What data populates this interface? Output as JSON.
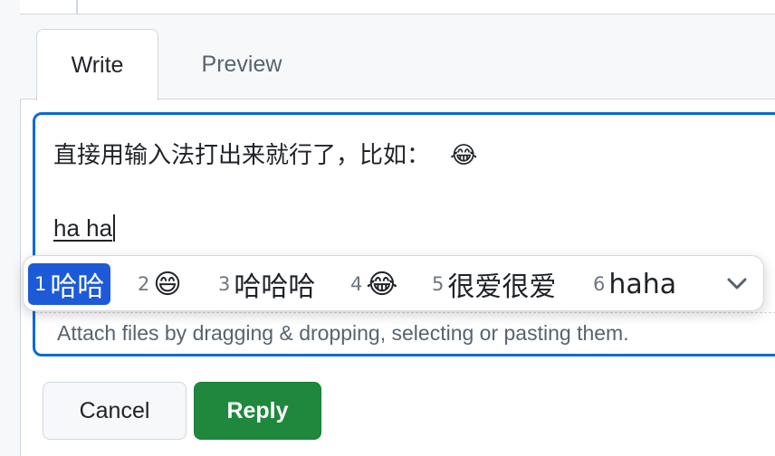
{
  "tabs": [
    {
      "label": "Write",
      "active": true
    },
    {
      "label": "Preview",
      "active": false
    }
  ],
  "editor": {
    "line1_text": "直接用输入法打出来就行了，比如：",
    "line1_emoji": "😂",
    "composing_text": "ha ha",
    "attach_hint": "Attach files by dragging & dropping, selecting or pasting them."
  },
  "ime": {
    "candidates": [
      {
        "num": "1",
        "text": "哈哈",
        "selected": true
      },
      {
        "num": "2",
        "text": "😄"
      },
      {
        "num": "3",
        "text": "哈哈哈"
      },
      {
        "num": "4",
        "text": "😂"
      },
      {
        "num": "5",
        "text": "很爱很爱"
      },
      {
        "num": "6",
        "text": "haha"
      }
    ],
    "expand_icon": "chevron-down-icon"
  },
  "buttons": {
    "cancel_label": "Cancel",
    "reply_label": "Reply"
  },
  "colors": {
    "accent_blue": "#0969da",
    "ime_selected": "#1d5ad8",
    "reply_green": "#1f883d"
  }
}
